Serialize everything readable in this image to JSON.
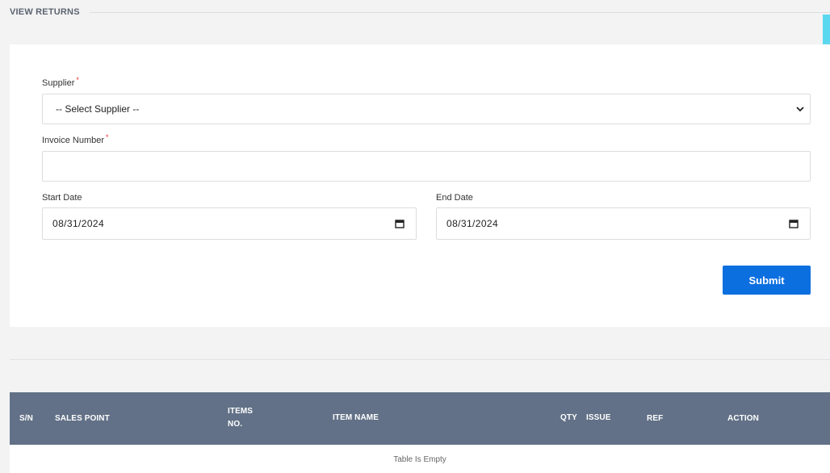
{
  "page": {
    "section_title": "VIEW RETURNS"
  },
  "form": {
    "supplier": {
      "label": "Supplier",
      "required_mark": "*",
      "selected": "-- Select Supplier --"
    },
    "invoice": {
      "label": "Invoice Number",
      "required_mark": "*",
      "value": ""
    },
    "start_date": {
      "label": "Start Date",
      "value": "08/31/2024"
    },
    "end_date": {
      "label": "End Date",
      "value": "08/31/2024"
    },
    "submit_label": "Submit"
  },
  "table": {
    "columns": [
      "S/N",
      "SALES POINT",
      "ITEMS",
      "NO.",
      "ITEM NAME",
      "QTY",
      "ISSUE",
      "REF",
      "ACTION"
    ],
    "empty_message": "Table Is Empty"
  },
  "colors": {
    "primary_button": "#0c6fe0",
    "table_header": "#627187",
    "accent": "#5bd8ef"
  }
}
